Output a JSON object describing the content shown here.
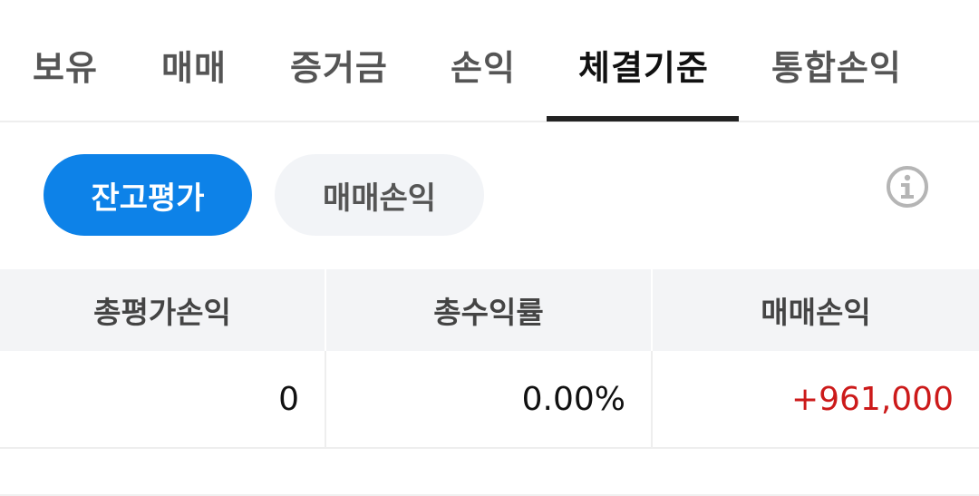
{
  "tabs": [
    {
      "label": "보유"
    },
    {
      "label": "매매"
    },
    {
      "label": "증거금"
    },
    {
      "label": "손익"
    },
    {
      "label": "체결기준"
    },
    {
      "label": "통합손익"
    }
  ],
  "active_tab": "체결기준",
  "segments": {
    "primary_label": "잔고평가",
    "secondary_label": "매매손익"
  },
  "icons": {
    "info": "info-icon"
  },
  "table": {
    "headers": [
      "총평가손익",
      "총수익률",
      "매매손익"
    ],
    "row": [
      "0",
      "0.00%",
      "+961,000"
    ]
  },
  "colors": {
    "accent": "#0d82e8",
    "positive": "#cc1a1a",
    "header_bg": "#f3f4f6"
  }
}
